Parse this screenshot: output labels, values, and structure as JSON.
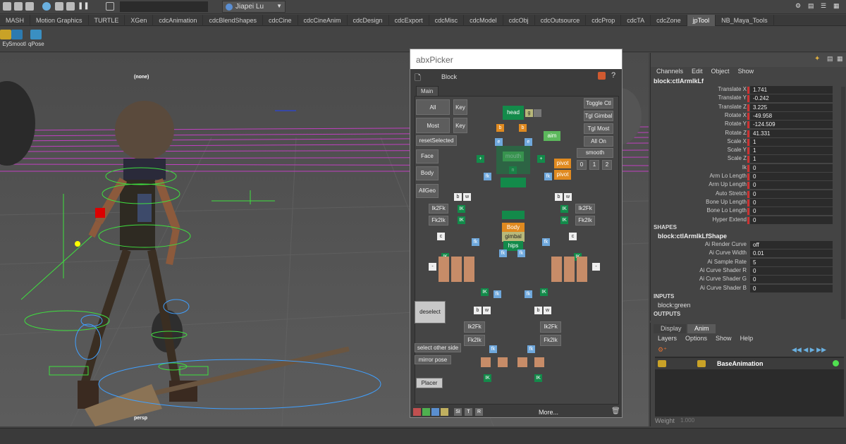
{
  "topbar": {
    "user": "Jiapei Lu"
  },
  "tabs": [
    "MASH",
    "Motion Graphics",
    "TURTLE",
    "XGen",
    "cdcAnimation",
    "cdcBlendShapes",
    "cdcCine",
    "cdcCineAnim",
    "cdcDesign",
    "cdcExport",
    "cdcMisc",
    "cdcModel",
    "cdcObj",
    "cdcOutsource",
    "cdcProp",
    "cdcTA",
    "cdcZone",
    "jpTool",
    "NB_Maya_Tools"
  ],
  "active_tab": "jpTool",
  "shelf": {
    "btn1": "Ey",
    "btn2": "Smootl",
    "btn3": "qPose"
  },
  "viewport": {
    "label_top": "(none)",
    "label_bottom": "persp"
  },
  "picker": {
    "title": "abxPicker",
    "menu_label": "Block",
    "help": "?",
    "tab_main": "Main",
    "buttons": {
      "all": "All",
      "key1": "Key",
      "most": "Most",
      "key2": "Key",
      "reset_selected": "resetSelected",
      "face": "Face",
      "body": "Body",
      "allgeo": "AllGeo",
      "toggle_ctl": "Toggle Ctl",
      "tgl_gimbal": "Tgl Gimbal",
      "tgl_most": "Tgl Most",
      "all_on": "All On",
      "smooth": "smooth",
      "n0": "0",
      "n1": "1",
      "n2": "2",
      "deselect": "deselect",
      "select_other_side": "select other side",
      "mirror_pose": "mirror pose",
      "placer": "Placer",
      "ik2fk_l": "Ik2Fk",
      "fk2ik_l": "Fk2Ik",
      "ik2fk_r": "Ik2Fk",
      "fk2ik_r": "Fk2Ik",
      "ik2fk_ll": "Ik2Fk",
      "fk2ik_ll": "Fk2Ik",
      "ik2fk_rl": "Ik2Fk",
      "fk2ik_rl": "Fk2Ik"
    },
    "labels": {
      "head": "head",
      "g": "g",
      "b": "b",
      "aim": "aim",
      "e": "e",
      "mouth": "mouth",
      "n": "n",
      "c": "c",
      "pivot1": "pivot",
      "pivot2": "pivot",
      "fk": "fk",
      "w": "w",
      "ik": "IK",
      "body": "Body",
      "gimbal": "gimbal",
      "hips": "hips",
      "plus": "+",
      "minus": "-"
    },
    "footer": {
      "s": "SI",
      "t": "T",
      "r": "R",
      "more": "More..."
    }
  },
  "channel_box": {
    "menu": [
      "Channels",
      "Edit",
      "Object",
      "Show"
    ],
    "node": "block:ctlArmIkLf",
    "attrs": [
      {
        "name": "Translate X",
        "value": "1.741"
      },
      {
        "name": "Translate Y",
        "value": "-0.242"
      },
      {
        "name": "Translate Z",
        "value": "3.225"
      },
      {
        "name": "Rotate X",
        "value": "-49.958"
      },
      {
        "name": "Rotate Y",
        "value": "-124.509"
      },
      {
        "name": "Rotate Z",
        "value": "41.331"
      },
      {
        "name": "Scale X",
        "value": "1"
      },
      {
        "name": "Scale Y",
        "value": "1"
      },
      {
        "name": "Scale Z",
        "value": "1"
      },
      {
        "name": "Ik",
        "value": "0"
      },
      {
        "name": "Arm Lo Length",
        "value": "0"
      },
      {
        "name": "Arm Up Length",
        "value": "0"
      },
      {
        "name": "Auto Stretch",
        "value": "0"
      },
      {
        "name": "Bone Up Length",
        "value": "0"
      },
      {
        "name": "Bone Lo Length",
        "value": "0"
      },
      {
        "name": "Hyper Extend",
        "value": "0"
      }
    ],
    "shapes_header": "SHAPES",
    "shape_node": "block:ctlArmIkLfShape",
    "shape_attrs": [
      {
        "name": "Ai Render Curve",
        "value": "off"
      },
      {
        "name": "Ai Curve Width",
        "value": "0.01"
      },
      {
        "name": "Ai Sample Rate",
        "value": "5"
      },
      {
        "name": "Ai Curve Shader R",
        "value": "0"
      },
      {
        "name": "Ai Curve Shader G",
        "value": "0"
      },
      {
        "name": "Ai Curve Shader B",
        "value": "0"
      }
    ],
    "inputs_header": "INPUTS",
    "input_node": "block:green",
    "outputs_header": "OUTPUTS"
  },
  "layer_editor": {
    "tabs": [
      "Display",
      "Anim"
    ],
    "active_tab": "Anim",
    "menu": [
      "Layers",
      "Options",
      "Show",
      "Help"
    ],
    "layer": "BaseAnimation",
    "weight_label": "Weight",
    "weight_value": "1.000"
  }
}
